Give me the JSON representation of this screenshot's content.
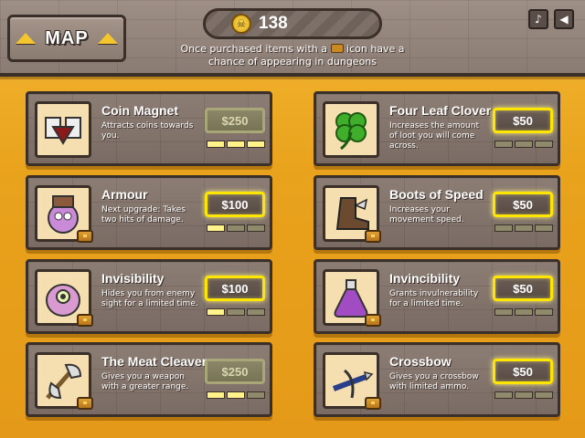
{
  "header": {
    "map_label": "MAP",
    "coins": "138",
    "notice_before": "Once purchased items with a",
    "notice_after": "icon have a chance of appearing in dungeons",
    "music_icon": "music-note-icon",
    "sound_icon": "speaker-icon"
  },
  "colors": {
    "background": "#eca623",
    "panel": "#857670",
    "active_price_border": "#ffe600",
    "disabled_price": "#8a8768"
  },
  "items": [
    {
      "name": "Coin Magnet",
      "desc": "Attracts coins towards you.",
      "price": "$250",
      "affordable": false,
      "levels_filled": 3,
      "levels_total": 3,
      "chest": false,
      "icon": "coin-magnet-icon"
    },
    {
      "name": "Four Leaf Clover",
      "desc": "Increases the amount of loot you will come across.",
      "price": "$50",
      "affordable": true,
      "levels_filled": 0,
      "levels_total": 3,
      "chest": false,
      "icon": "clover-icon"
    },
    {
      "name": "Armour",
      "desc": "Next upgrade: Takes two hits of damage.",
      "price": "$100",
      "affordable": true,
      "levels_filled": 1,
      "levels_total": 3,
      "chest": true,
      "icon": "armour-icon"
    },
    {
      "name": "Boots of Speed",
      "desc": "Increases your movement speed.",
      "price": "$50",
      "affordable": true,
      "levels_filled": 0,
      "levels_total": 3,
      "chest": true,
      "icon": "boots-icon"
    },
    {
      "name": "Invisibility",
      "desc": "Hides you from enemy sight for a limited time.",
      "price": "$100",
      "affordable": true,
      "levels_filled": 1,
      "levels_total": 3,
      "chest": true,
      "icon": "invisibility-icon"
    },
    {
      "name": "Invincibility",
      "desc": "Grants invulnerability for a limited time.",
      "price": "$50",
      "affordable": true,
      "levels_filled": 0,
      "levels_total": 3,
      "chest": true,
      "icon": "potion-icon"
    },
    {
      "name": "The Meat Cleaver",
      "desc": "Gives you a weapon with a greater range.",
      "price": "$250",
      "affordable": false,
      "levels_filled": 2,
      "levels_total": 3,
      "chest": true,
      "icon": "axe-icon"
    },
    {
      "name": "Crossbow",
      "desc": "Gives you a crossbow with limited ammo.",
      "price": "$50",
      "affordable": true,
      "levels_filled": 0,
      "levels_total": 3,
      "chest": true,
      "icon": "crossbow-icon"
    }
  ]
}
